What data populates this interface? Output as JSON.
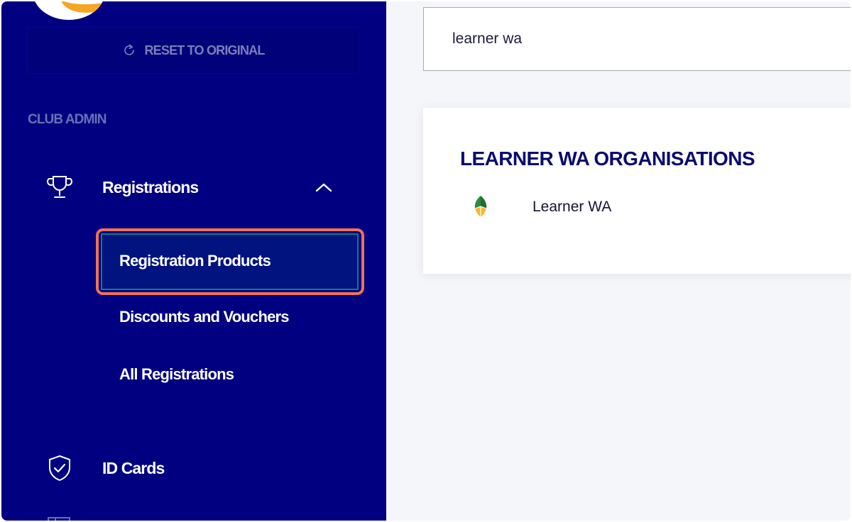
{
  "sidebar": {
    "reset_label": "RESET TO ORIGINAL",
    "section_title": "CLUB ADMIN",
    "registrations": {
      "label": "Registrations",
      "expanded": true,
      "sub_items": [
        {
          "label": "Registration Products",
          "active": true
        },
        {
          "label": "Discounts and Vouchers",
          "active": false
        },
        {
          "label": "All Registrations",
          "active": false
        }
      ]
    },
    "id_cards": {
      "label": "ID Cards"
    },
    "icons": {
      "reset": "refresh-icon",
      "registrations": "trophy-icon",
      "collapse": "chevron-up-icon",
      "id_cards": "shield-check-icon"
    }
  },
  "main": {
    "search": {
      "value": "learner wa"
    },
    "results": {
      "heading": "LEARNER WA ORGANISATIONS",
      "items": [
        {
          "name": "Learner WA",
          "logo": "organisation-logo-icon"
        }
      ]
    }
  },
  "colors": {
    "sidebar_bg": "#000080",
    "active_item_bg": "#00137f",
    "highlight_outline": "#f07155",
    "heading_text": "#0b0b6e",
    "brand_orange": "#f5a623"
  }
}
